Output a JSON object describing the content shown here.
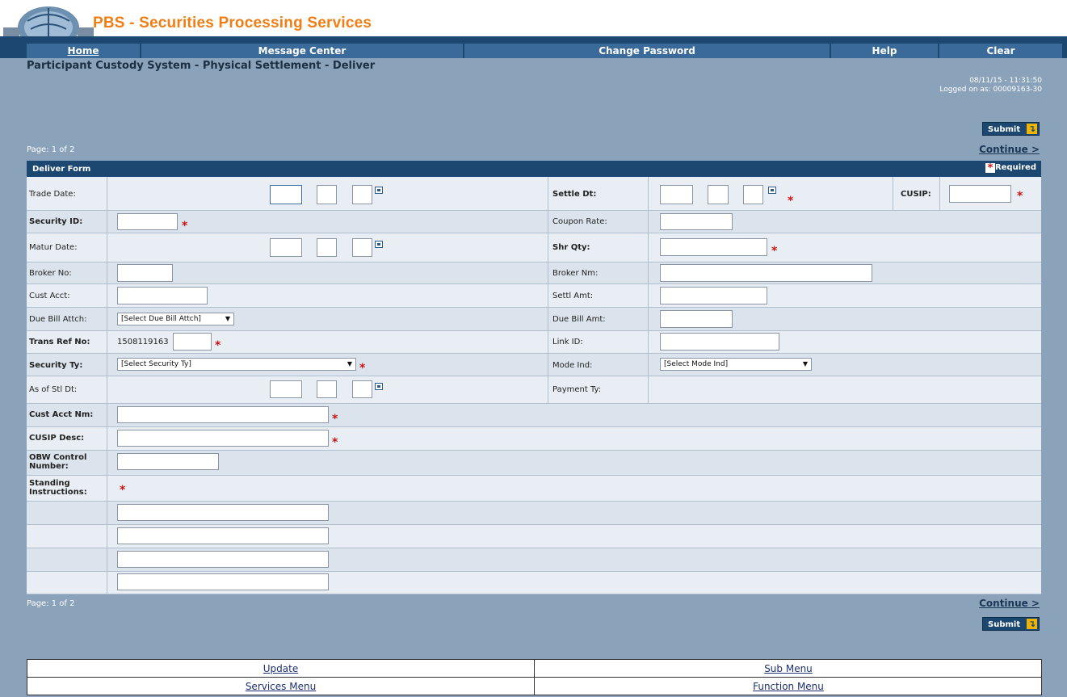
{
  "app": {
    "title": "PBS - Securities Processing Services"
  },
  "nav": [
    {
      "label": "Home"
    },
    {
      "label": "Message Center"
    },
    {
      "label": "Change Password"
    },
    {
      "label": "Help"
    },
    {
      "label": "Clear"
    }
  ],
  "page": {
    "title": "Participant Custody System - Physical Settlement - Deliver",
    "datetime": "08/11/15 - 11:31:50",
    "logged_on": "Logged on as:  00009163-30",
    "page_info": "Page: 1 of 2",
    "continue": "Continue >",
    "submit": "Submit"
  },
  "form": {
    "title": "Deliver Form",
    "required_legend": "= Required",
    "labels": {
      "trade_date": "Trade Date:",
      "settle_dt": "Settle Dt:",
      "cusip": "CUSIP:",
      "security_id": "Security ID:",
      "coupon_rate": "Coupon Rate:",
      "matur_date": "Matur Date:",
      "shr_qty": "Shr Qty:",
      "broker_no": "Broker No:",
      "broker_nm": "Broker Nm:",
      "cust_acct": "Cust Acct:",
      "settl_amt": "Settl Amt:",
      "due_bill_attch": "Due Bill Attch:",
      "due_bill_amt": "Due Bill Amt:",
      "trans_ref_no": "Trans Ref No:",
      "link_id": "Link ID:",
      "security_ty": "Security Ty:",
      "mode_ind": "Mode Ind:",
      "as_of_stl_dt": "As of Stl Dt:",
      "payment_ty": "Payment Ty:",
      "cust_acct_nm": "Cust Acct Nm:",
      "cusip_desc": "CUSIP Desc:",
      "obw_control": "OBW Control Number:",
      "standing_instructions": "Standing Instructions:"
    },
    "values": {
      "trans_ref_prefix": "1508119163"
    },
    "selects": {
      "due_bill_attch": "[Select Due Bill Attch]",
      "security_ty": "[Select Security Ty]",
      "mode_ind": "[Select Mode Ind]"
    }
  },
  "bottom_menu": [
    {
      "label": "Update"
    },
    {
      "label": "Sub Menu"
    },
    {
      "label": "Services Menu"
    },
    {
      "label": "Function Menu"
    }
  ],
  "colors": {
    "accent": "#f07e14",
    "nav": "#1b4770",
    "background": "#8aa3bb",
    "required": "#c81414"
  }
}
